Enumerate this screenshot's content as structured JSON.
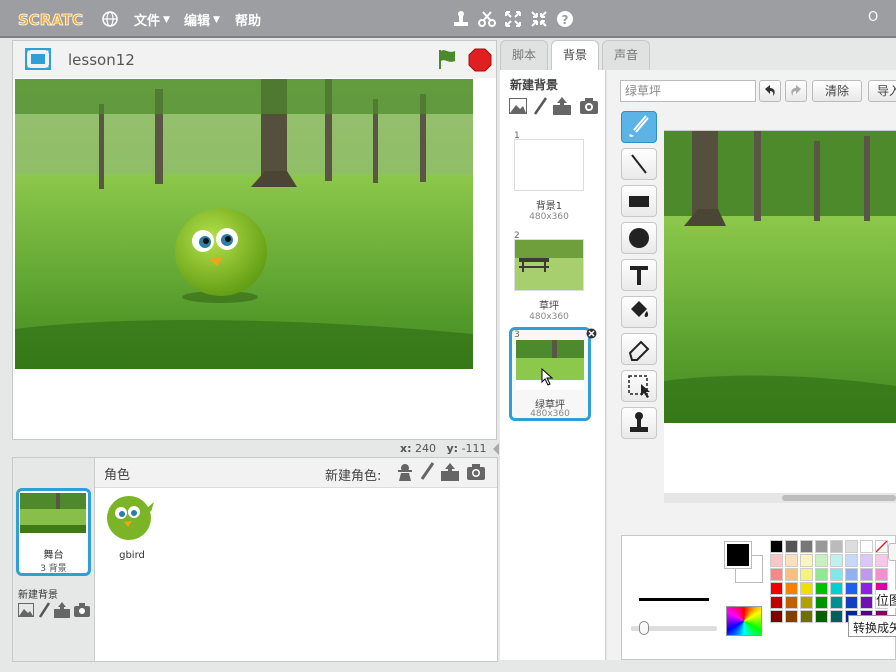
{
  "menubar": {
    "logo_text": "SCRATCH",
    "file": "文件",
    "edit": "编辑",
    "help": "帮助",
    "right_text": "O"
  },
  "stage": {
    "project_title": "lesson12",
    "coords_x_label": "x:",
    "coords_x": "240",
    "coords_y_label": "y:",
    "coords_y": "-111"
  },
  "sprites": {
    "header": "角色",
    "new_sprite_label": "新建角色:",
    "items": [
      {
        "name": "gbird"
      }
    ],
    "stage_item": {
      "name": "舞台",
      "sub": "3 背景"
    },
    "new_backdrop_label": "新建背景"
  },
  "tabs": [
    "脚本",
    "背景",
    "声音"
  ],
  "backdrops": {
    "new_label": "新建背景",
    "items": [
      {
        "num": "1",
        "name": "背景1",
        "size": "480x360"
      },
      {
        "num": "2",
        "name": "草坪",
        "size": "480x360"
      },
      {
        "num": "3",
        "name": "绿草坪",
        "size": "480x360"
      }
    ]
  },
  "editor": {
    "name_value": "绿草坪",
    "clear_button": "清除",
    "import_button": "导入",
    "partial_label_1": "位图",
    "partial_label_2": "转换成矢"
  },
  "colors": {
    "accent_blue": "#2f9fd8",
    "menubar": "#9c9ea2",
    "stop_red": "#e02020",
    "flag_green": "#4a8a2a"
  }
}
